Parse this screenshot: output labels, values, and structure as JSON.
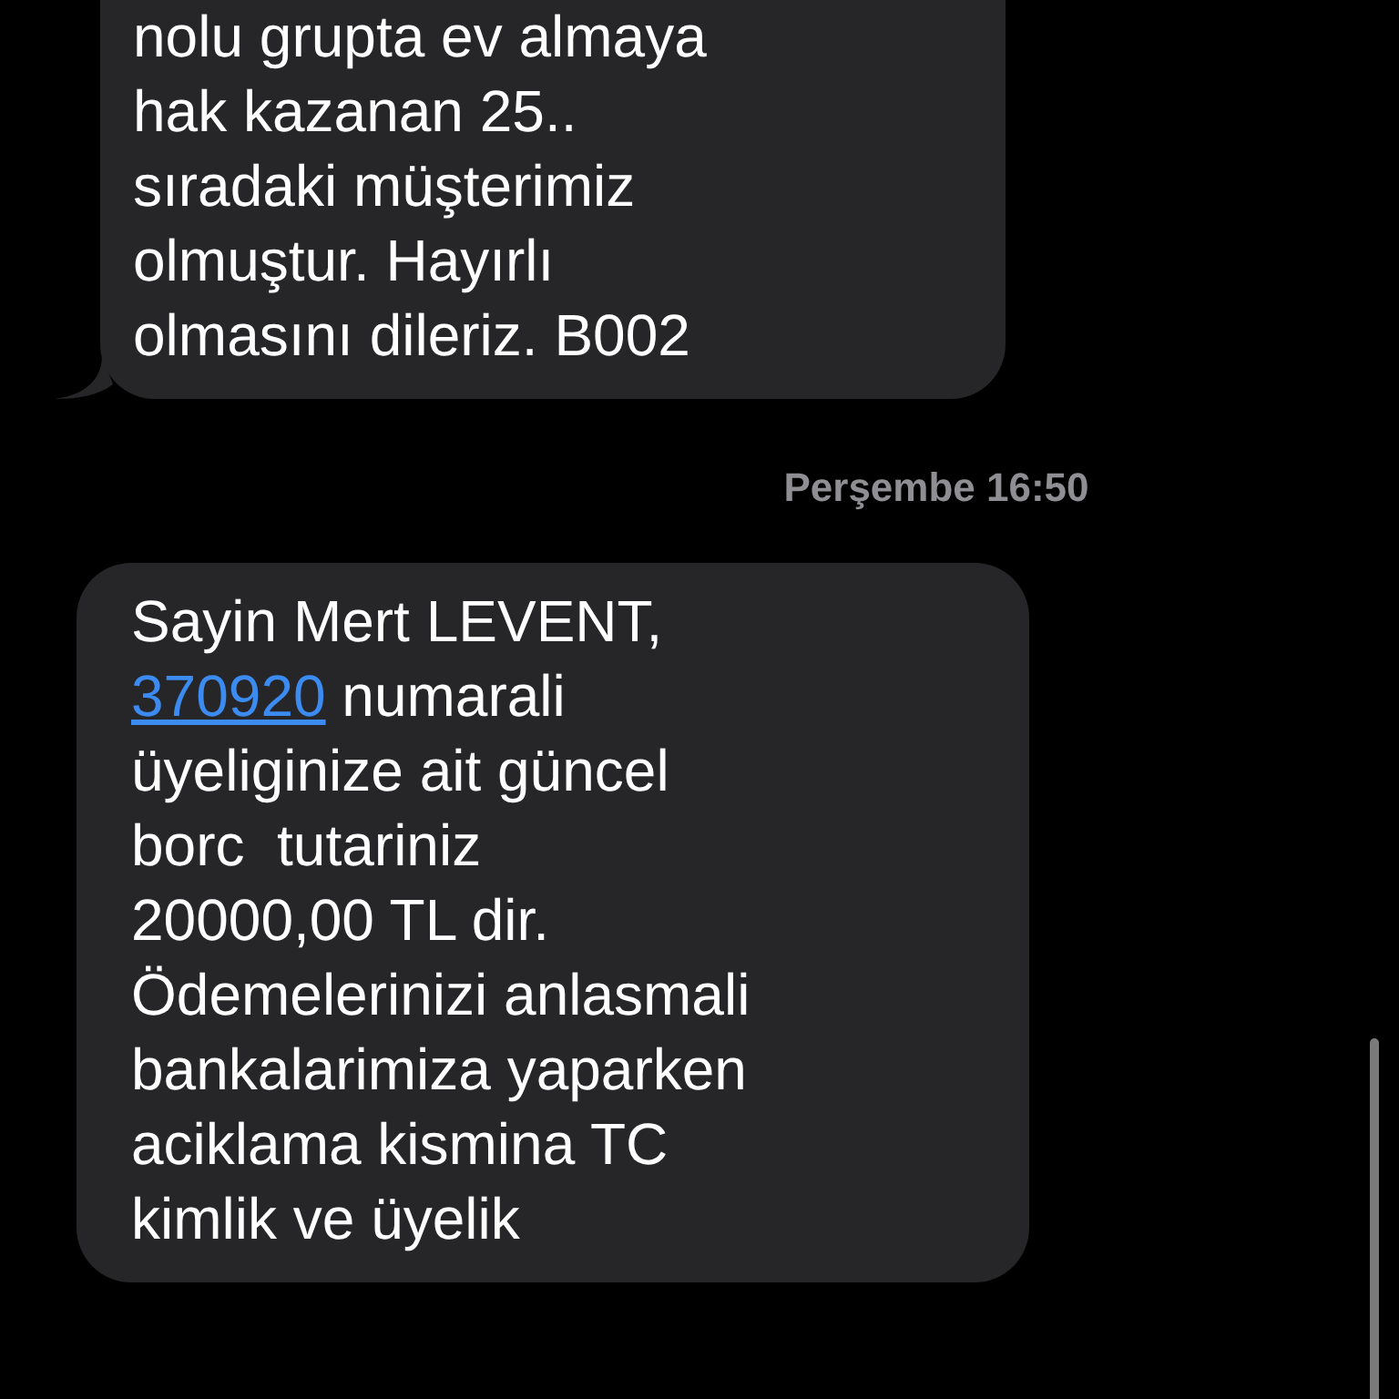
{
  "messages": [
    {
      "kind": "received",
      "tail": true,
      "text": "nolu grupta ev almaya\nhak kazanan 25..\nsıradaki müşterimiz\nolmuştur. Hayırlı\nolmasını dileriz. B002"
    },
    {
      "kind": "timestamp",
      "text": "Perşembe 16:50"
    },
    {
      "kind": "received",
      "tail": false,
      "text": "Sayin Mert LEVENT,\n",
      "link": "370920",
      "text_after": " numarali\nüyeliginize ait güncel\nborc  tutariniz\n20000,00 TL dir.\nÖdemelerinizi anlasmali\nbankalarimiza yaparken\naciklama kismina TC\nkimlik ve üyelik"
    }
  ]
}
